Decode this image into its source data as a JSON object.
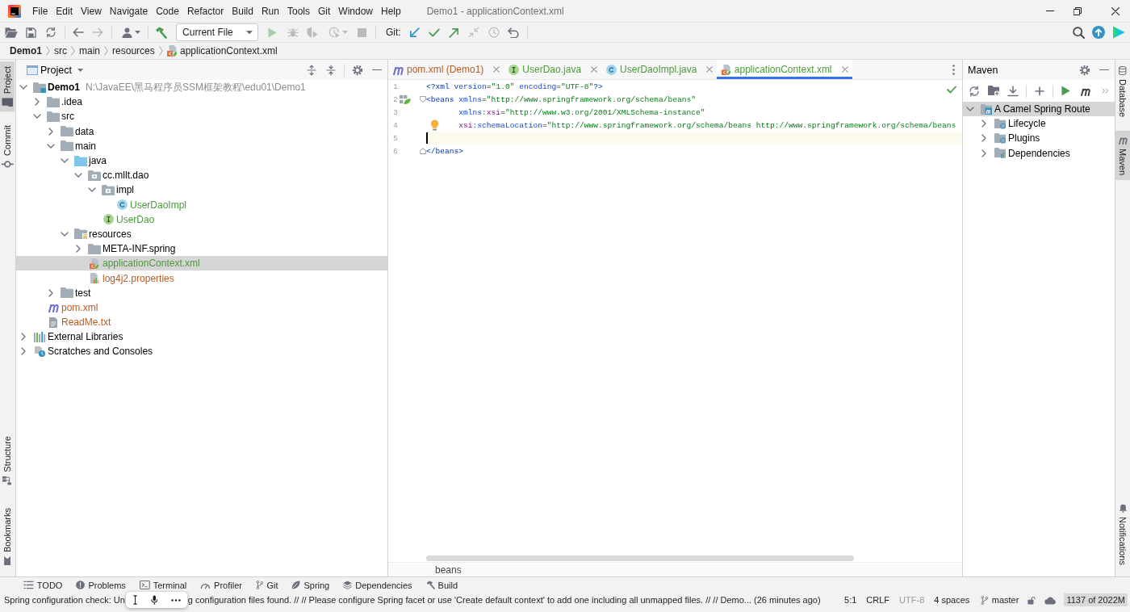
{
  "window": {
    "title": "Demo1 - applicationContext.xml"
  },
  "menu": [
    "File",
    "Edit",
    "View",
    "Navigate",
    "Code",
    "Refactor",
    "Build",
    "Run",
    "Tools",
    "Git",
    "Window",
    "Help"
  ],
  "toolbar": {
    "left": [
      {
        "kind": "open",
        "disabled": false
      },
      {
        "kind": "save",
        "disabled": false
      },
      {
        "kind": "sync",
        "disabled": false
      },
      {
        "kind": "separator"
      },
      {
        "kind": "back",
        "disabled": false
      },
      {
        "kind": "forward",
        "disabled": true
      },
      {
        "kind": "separator"
      },
      {
        "kind": "vcs-user",
        "disabled": false
      },
      {
        "kind": "separator"
      },
      {
        "kind": "build",
        "disabled": false
      },
      {
        "kind": "run-config",
        "label": "Current File"
      },
      {
        "kind": "run",
        "disabled": true
      },
      {
        "kind": "debug",
        "disabled": true
      },
      {
        "kind": "coverage",
        "disabled": true
      },
      {
        "kind": "profile",
        "disabled": true
      },
      {
        "kind": "stop",
        "disabled": true
      },
      {
        "kind": "separator"
      },
      {
        "kind": "vcs-label",
        "label": "Git:"
      },
      {
        "kind": "vcs-update",
        "disabled": false
      },
      {
        "kind": "vcs-commit",
        "disabled": false
      },
      {
        "kind": "vcs-push",
        "disabled": false
      },
      {
        "kind": "vcs-merge",
        "disabled": true
      },
      {
        "kind": "vcs-history",
        "disabled": true
      },
      {
        "kind": "vcs-rollback",
        "disabled": false
      },
      {
        "kind": "separator"
      }
    ]
  },
  "navigation_bar": [
    {
      "label": "Demo1",
      "kind": "module"
    },
    {
      "label": "src",
      "kind": "folder"
    },
    {
      "label": "main",
      "kind": "folder"
    },
    {
      "label": "resources",
      "kind": "folder"
    },
    {
      "label": "applicationContext.xml",
      "kind": "spring-xml"
    }
  ],
  "left_stripe": {
    "top": [
      {
        "label": "Project",
        "kind": "project",
        "selected": true
      },
      {
        "label": "Commit",
        "kind": "commit",
        "selected": false
      }
    ],
    "bottom": [
      {
        "label": "Structure",
        "kind": "structure",
        "selected": false
      },
      {
        "label": "Bookmarks",
        "kind": "bookmarks",
        "selected": false
      }
    ]
  },
  "project": {
    "title": "Project",
    "tree": [
      {
        "label": "Demo1",
        "path": "N:\\JavaEE\\黑马程序员SSM框架教程\\edu01\\Demo1",
        "kind": "module",
        "expanded": true,
        "selected": false,
        "children": [
          {
            "label": ".idea",
            "kind": "folder",
            "expanded": false,
            "selected": false
          },
          {
            "label": "src",
            "kind": "folder",
            "expanded": true,
            "selected": false,
            "children": [
              {
                "label": "data",
                "kind": "folder",
                "expanded": false,
                "selected": false
              },
              {
                "label": "main",
                "kind": "folder",
                "expanded": true,
                "selected": false,
                "children": [
                  {
                    "label": "java",
                    "kind": "source-folder",
                    "expanded": true,
                    "selected": false,
                    "children": [
                      {
                        "label": "cc.mllt.dao",
                        "kind": "package",
                        "expanded": true,
                        "selected": false,
                        "children": [
                          {
                            "label": "impl",
                            "kind": "package",
                            "expanded": true,
                            "selected": false,
                            "children": [
                              {
                                "label": "UserDaoImpl",
                                "kind": "class",
                                "color": "#4b9a3a",
                                "selected": false
                              }
                            ]
                          },
                          {
                            "label": "UserDao",
                            "kind": "interface",
                            "color": "#4b9a3a",
                            "selected": false
                          }
                        ]
                      }
                    ]
                  },
                  {
                    "label": "resources",
                    "kind": "resources-folder",
                    "expanded": true,
                    "selected": false,
                    "children": [
                      {
                        "label": "META-INF.spring",
                        "kind": "folder",
                        "expanded": false,
                        "selected": false
                      },
                      {
                        "label": "applicationContext.xml",
                        "kind": "spring-xml",
                        "color": "#4b9a3a",
                        "selected": true
                      },
                      {
                        "label": "log4j2.properties",
                        "kind": "properties",
                        "color": "#b85a25",
                        "selected": false
                      }
                    ]
                  }
                ]
              },
              {
                "label": "test",
                "kind": "folder",
                "expanded": false,
                "selected": false
              }
            ]
          },
          {
            "label": "pom.xml",
            "kind": "maven",
            "color": "#b85a25",
            "selected": false
          },
          {
            "label": "ReadMe.txt",
            "kind": "text",
            "color": "#b85a25",
            "selected": false
          }
        ]
      },
      {
        "label": "External Libraries",
        "kind": "libraries",
        "expanded": false,
        "selected": false
      },
      {
        "label": "Scratches and Consoles",
        "kind": "scratches",
        "expanded": false,
        "selected": false
      }
    ]
  },
  "editor": {
    "tabs": [
      {
        "label": "pom.xml (Demo1)",
        "kind": "maven",
        "color": "#b85a25",
        "selected": false
      },
      {
        "label": "UserDao.java",
        "kind": "interface",
        "color": "#4b9a3a",
        "selected": false
      },
      {
        "label": "UserDaoImpl.java",
        "kind": "class",
        "color": "#4b9a3a",
        "selected": false
      },
      {
        "label": "applicationContext.xml",
        "kind": "spring-xml",
        "color": "#4b9a3a",
        "selected": true
      }
    ],
    "inspection_passed": true,
    "lines": [
      {
        "number": "1",
        "current": false,
        "indented": false,
        "bean_marker": false,
        "intention": false,
        "fold_start": false,
        "fold_end": false,
        "tokens": [
          {
            "kind": "tag",
            "text": "<?xml"
          },
          {
            "kind": "attribute",
            "text": " version"
          },
          {
            "kind": "plain",
            "text": "="
          },
          {
            "kind": "value",
            "text": "\"1.0\""
          },
          {
            "kind": "attribute",
            "text": " encoding"
          },
          {
            "kind": "plain",
            "text": "="
          },
          {
            "kind": "value",
            "text": "\"UTF-8\""
          },
          {
            "kind": "tag",
            "text": "?>"
          }
        ]
      },
      {
        "number": "2",
        "current": false,
        "indented": false,
        "bean_marker": true,
        "intention": false,
        "fold_start": true,
        "fold_end": false,
        "tokens": [
          {
            "kind": "tag",
            "text": "<beans"
          },
          {
            "kind": "attribute",
            "text": " xmlns"
          },
          {
            "kind": "plain",
            "text": "="
          },
          {
            "kind": "value",
            "text": "\"http://www.springframework.org/schema/beans\""
          }
        ]
      },
      {
        "number": "3",
        "current": false,
        "indented": true,
        "bean_marker": false,
        "intention": false,
        "fold_start": false,
        "fold_end": false,
        "tokens": [
          {
            "kind": "attribute",
            "text": "xmlns:"
          },
          {
            "kind": "namespace",
            "text": "xsi"
          },
          {
            "kind": "plain",
            "text": "="
          },
          {
            "kind": "value",
            "text": "\"http://www.w3.org/2001/XMLSchema-instance\""
          }
        ]
      },
      {
        "number": "4",
        "current": false,
        "indented": true,
        "bean_marker": false,
        "intention": true,
        "fold_start": false,
        "fold_end": false,
        "tokens": [
          {
            "kind": "namespace",
            "text": "xsi"
          },
          {
            "kind": "attribute",
            "text": ":schemaLocation"
          },
          {
            "kind": "plain",
            "text": "="
          },
          {
            "kind": "value",
            "text": "\"http://www.springframework.org/schema/beans http://www.springframework.org/schema/beans"
          }
        ]
      },
      {
        "number": "5",
        "current": true,
        "indented": false,
        "bean_marker": false,
        "intention": false,
        "fold_start": false,
        "fold_end": false
      },
      {
        "number": "6",
        "current": false,
        "indented": false,
        "bean_marker": false,
        "intention": false,
        "fold_start": false,
        "fold_end": true,
        "tokens": [
          {
            "kind": "tag",
            "text": "</beans>"
          }
        ]
      }
    ],
    "breadcrumb": "beans"
  },
  "maven": {
    "title": "Maven",
    "tree": [
      {
        "label": "A Camel Spring Route",
        "kind": "maven-project",
        "expanded": true,
        "selected": true,
        "children": [
          {
            "label": "Lifecycle",
            "kind": "lifecycle",
            "expanded": false,
            "selected": false
          },
          {
            "label": "Plugins",
            "kind": "plugins",
            "expanded": false,
            "selected": false
          },
          {
            "label": "Dependencies",
            "kind": "dependencies",
            "expanded": false,
            "selected": false
          }
        ]
      }
    ]
  },
  "right_stripe": {
    "top": [
      {
        "label": "Database",
        "kind": "database",
        "selected": false
      },
      {
        "label": "Maven",
        "kind": "maven",
        "selected": true
      }
    ],
    "bottom": [
      {
        "label": "Notifications",
        "kind": "notifications",
        "selected": false
      }
    ]
  },
  "tool_windows": [
    {
      "label": "TODO",
      "kind": "todo"
    },
    {
      "label": "Problems",
      "kind": "problems"
    },
    {
      "label": "Terminal",
      "kind": "terminal"
    },
    {
      "label": "Profiler",
      "kind": "profiler"
    },
    {
      "label": "Git",
      "kind": "git"
    },
    {
      "label": "Spring",
      "kind": "spring"
    },
    {
      "label": "Dependencies",
      "kind": "dependencies"
    },
    {
      "label": "Build",
      "kind": "build"
    }
  ],
  "status_bar": {
    "message": [
      "Spring configuration check: Un",
      "g configuration files found. // // Please configure Spring facet or use 'Create default context' to add one including all unmapped files. // // Demo... (26 minutes ago)"
    ],
    "caret_position": "5:1",
    "line_separator": "CRLF",
    "encoding": {
      "label": "UTF-8",
      "disabled": true
    },
    "indent": "4 spaces",
    "branch": "master",
    "memory": "1137 of 2022M"
  }
}
